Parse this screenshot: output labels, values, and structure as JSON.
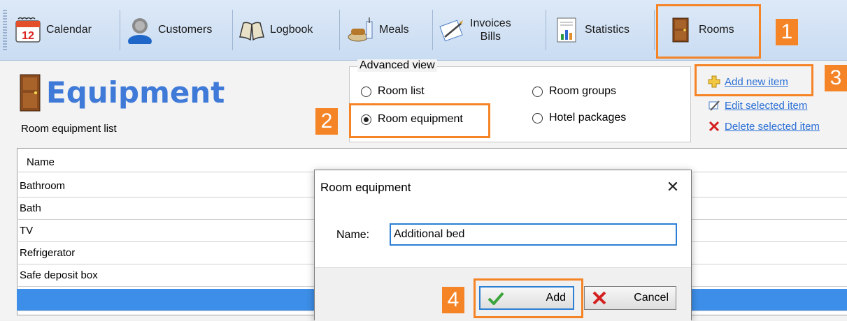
{
  "toolbar": {
    "items": [
      {
        "label": "Calendar",
        "icon": "calendar-icon",
        "badge": "12"
      },
      {
        "label": "Customers",
        "icon": "customers-icon"
      },
      {
        "label": "Logbook",
        "icon": "logbook-icon"
      },
      {
        "label": "Meals",
        "icon": "meals-icon"
      },
      {
        "label_line1": "Invoices",
        "label_line2": "Bills",
        "icon": "invoices-icon"
      },
      {
        "label": "Statistics",
        "icon": "statistics-icon"
      },
      {
        "label": "Rooms",
        "icon": "door-icon"
      }
    ]
  },
  "page": {
    "title": "Equipment",
    "subtitle": "Room equipment list"
  },
  "advanced_view": {
    "legend": "Advanced view",
    "options": [
      {
        "label": "Room list",
        "selected": false
      },
      {
        "label": "Room groups",
        "selected": false
      },
      {
        "label": "Room equipment",
        "selected": true
      },
      {
        "label": "Hotel packages",
        "selected": false
      }
    ]
  },
  "actions": {
    "add": "Add new item",
    "edit": "Edit selected item",
    "delete": "Delete selected item"
  },
  "table": {
    "header": "Name",
    "rows": [
      "Bathroom",
      "Bath",
      "TV",
      "Refrigerator",
      "Safe deposit box",
      ""
    ]
  },
  "dialog": {
    "title": "Room equipment",
    "name_label": "Name:",
    "name_value": "Additional bed",
    "add_label": "Add",
    "cancel_label": "Cancel"
  },
  "steps": [
    "1",
    "2",
    "3",
    "4"
  ],
  "colors": {
    "accent": "#f58426",
    "title": "#3f7ad8",
    "link": "#2a6fd6",
    "selection": "#3d8ee8"
  }
}
